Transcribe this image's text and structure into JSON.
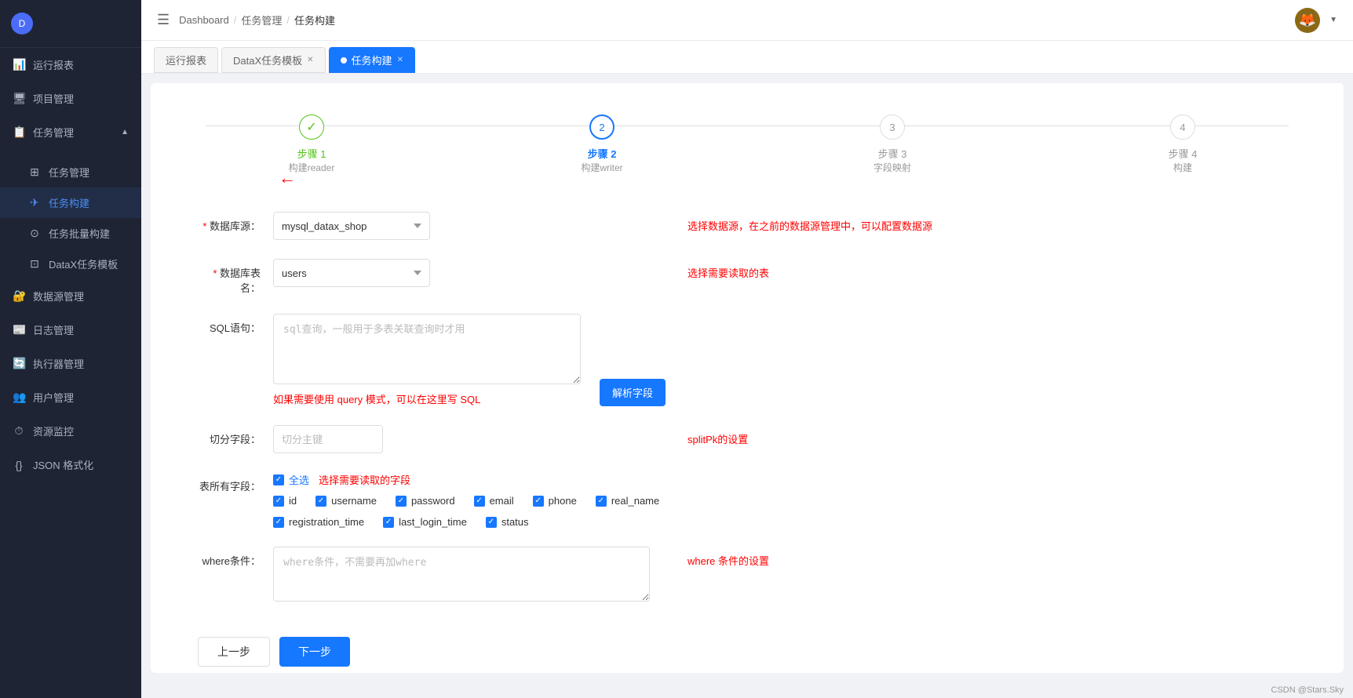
{
  "sidebar": {
    "items": [
      {
        "id": "run-report",
        "label": "运行报表",
        "icon": "📊",
        "active": false
      },
      {
        "id": "project-mgmt",
        "label": "项目管理",
        "icon": "📁",
        "active": false
      },
      {
        "id": "task-mgmt",
        "label": "任务管理",
        "icon": "📋",
        "active": true,
        "expanded": true,
        "children": [
          {
            "id": "task-manage",
            "label": "任务管理",
            "icon": "⊞",
            "active": false
          },
          {
            "id": "task-build",
            "label": "任务构建",
            "icon": "✈",
            "active": true
          },
          {
            "id": "task-batch",
            "label": "任务批量构建",
            "icon": "⊙",
            "active": false
          },
          {
            "id": "datax-template",
            "label": "DataX任务模板",
            "icon": "⊡",
            "active": false
          }
        ]
      },
      {
        "id": "datasource-mgmt",
        "label": "数据源管理",
        "icon": "🔐",
        "active": false
      },
      {
        "id": "log-mgmt",
        "label": "日志管理",
        "icon": "📰",
        "active": false
      },
      {
        "id": "executor-mgmt",
        "label": "执行器管理",
        "icon": "🔄",
        "active": false
      },
      {
        "id": "user-mgmt",
        "label": "用户管理",
        "icon": "👥",
        "active": false
      },
      {
        "id": "resource-monitor",
        "label": "资源监控",
        "icon": "⏱",
        "active": false
      },
      {
        "id": "json-format",
        "label": "JSON 格式化",
        "icon": "{}",
        "active": false
      }
    ]
  },
  "header": {
    "hamburger": "☰",
    "breadcrumb": [
      "Dashboard",
      "任务管理",
      "任务构建"
    ],
    "avatar": "🦊"
  },
  "tabs": [
    {
      "label": "运行报表",
      "active": false,
      "closable": false
    },
    {
      "label": "DataX任务模板",
      "active": false,
      "closable": true
    },
    {
      "label": "任务构建",
      "active": true,
      "closable": true
    }
  ],
  "steps": [
    {
      "number": "✓",
      "title": "步骤 1",
      "sub": "构建reader",
      "status": "done"
    },
    {
      "number": "2",
      "title": "步骤 2",
      "sub": "构建writer",
      "status": "active"
    },
    {
      "number": "3",
      "title": "步骤 3",
      "sub": "字段映射",
      "status": "pending"
    },
    {
      "number": "4",
      "title": "步骤 4",
      "sub": "构建",
      "status": "pending"
    }
  ],
  "form": {
    "datasource_label": "数据库源：",
    "datasource_value": "mysql_datax_shop",
    "datasource_hint": "选择数据源，在之前的数据源管理中，可以配置数据源",
    "table_label": "数据库表名：",
    "table_value": "users",
    "table_hint": "选择需要读取的表",
    "sql_label": "SQL语句：",
    "sql_placeholder": "sql查询，一般用于多表关联查询时才用",
    "sql_hint": "如果需要使用 query 模式，可以在这里写 SQL",
    "parse_btn": "解析字段",
    "split_label": "切分字段：",
    "split_placeholder": "切分主键",
    "split_hint": "splitPk的设置",
    "all_fields_label": "表所有字段：",
    "select_all": "全选",
    "fields_hint": "选择需要读取的字段",
    "fields": [
      "id",
      "username",
      "password",
      "email",
      "phone",
      "real_name",
      "registration_time",
      "last_login_time",
      "status"
    ],
    "where_label": "where条件：",
    "where_placeholder": "where条件，不需要再加where",
    "where_hint": "where 条件的设置",
    "prev_btn": "上一步",
    "next_btn": "下一步"
  },
  "footer": "CSDN @Stars.Sky"
}
